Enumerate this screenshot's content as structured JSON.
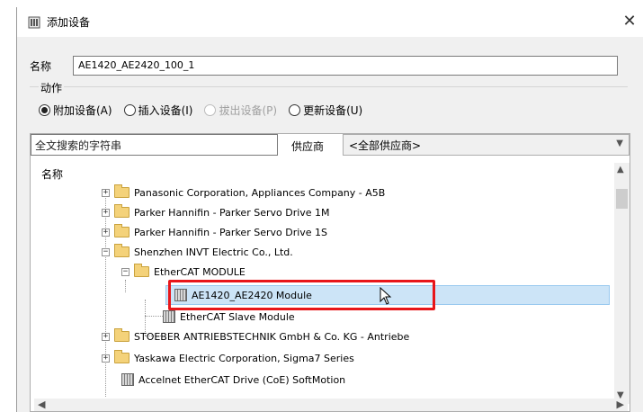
{
  "window": {
    "title": "添加设备",
    "close_glyph": "✕"
  },
  "name_field": {
    "label": "名称",
    "value": "AE1420_AE2420_100_1"
  },
  "action": {
    "caption": "动作",
    "options": [
      {
        "label": "附加设备(A)",
        "checked": true,
        "enabled": true
      },
      {
        "label": "插入设备(I)",
        "checked": false,
        "enabled": true
      },
      {
        "label": "拔出设备(P)",
        "checked": false,
        "enabled": false
      },
      {
        "label": "更新设备(U)",
        "checked": false,
        "enabled": true
      }
    ]
  },
  "search": {
    "value": "全文搜索的字符串",
    "vendor_label": "供应商",
    "vendor_value": "<全部供应商>"
  },
  "tree": {
    "column_header": "名称",
    "rows": [
      {
        "label": "Panasonic Corporation, Appliances Company - A5B",
        "type": "folder",
        "expander": "+"
      },
      {
        "label": "Parker Hannifin - Parker Servo Drive 1M",
        "type": "folder",
        "expander": "+"
      },
      {
        "label": "Parker Hannifin - Parker Servo Drive 1S",
        "type": "folder",
        "expander": "+"
      },
      {
        "label": "Shenzhen INVT Electric Co., Ltd.",
        "type": "folder",
        "expander": "−"
      },
      {
        "label": "EtherCAT MODULE",
        "type": "folder",
        "expander": "−"
      },
      {
        "label": "AE1420_AE2420 Module",
        "type": "module",
        "selected": true
      },
      {
        "label": "EtherCAT Slave Module",
        "type": "module"
      },
      {
        "label": "STOEBER ANTRIEBSTECHNIK GmbH & Co. KG - Antriebe",
        "type": "folder",
        "expander": "+"
      },
      {
        "label": "Yaskawa Electric Corporation, Sigma7 Series",
        "type": "folder",
        "expander": "+"
      },
      {
        "label": "Accelnet EtherCAT Drive (CoE) SoftMotion",
        "type": "module"
      }
    ]
  },
  "colors": {
    "selection": "#cce4f7",
    "highlight_border": "#e8161a",
    "folder": "#f4d27a"
  }
}
